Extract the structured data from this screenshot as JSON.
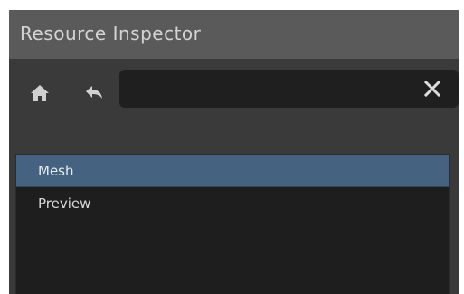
{
  "panel": {
    "title": "Resource Inspector"
  },
  "toolbar": {
    "home_icon": "home-icon",
    "back_icon": "back-arrow-icon",
    "search": {
      "value": "",
      "placeholder": ""
    },
    "clear_icon": "close-icon"
  },
  "list": {
    "items": [
      {
        "label": "Mesh",
        "selected": true
      },
      {
        "label": "Preview",
        "selected": false
      }
    ]
  },
  "colors": {
    "panel_bg": "#3a3a3a",
    "titlebar_bg": "#5a5a5a",
    "list_bg": "#1e1e1e",
    "selected_bg": "#456380",
    "text": "#d8d8d8"
  }
}
